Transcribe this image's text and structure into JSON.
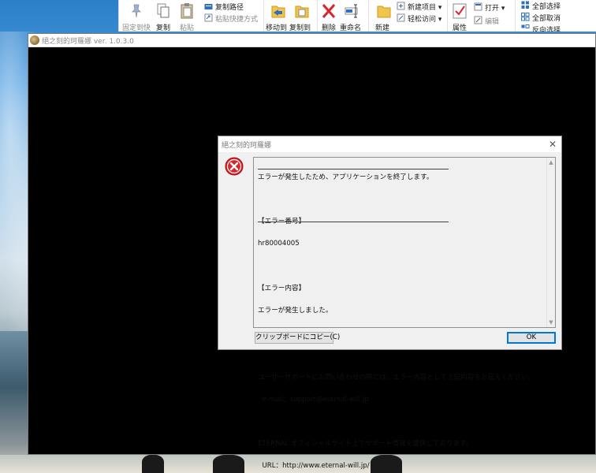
{
  "ribbon": {
    "pin_label": "固定到快",
    "copy_label": "复制",
    "paste_label": "粘贴",
    "copy_path_label": "复制路径",
    "paste_shortcut_label": "粘贴快捷方式",
    "move_to_label": "移动到",
    "copy_to_label": "复制到",
    "delete_label": "删除",
    "rename_label": "重命名",
    "new_folder_label": "新建",
    "new_item_label": "新建项目 ▾",
    "easy_access_label": "轻松访问 ▾",
    "properties_label": "属性",
    "open_label": "打开 ▾",
    "edit_label": "编辑",
    "select_all_label": "全部选择",
    "select_none_label": "全部取消",
    "invert_selection_label": "反向选择"
  },
  "game_window": {
    "title": "絕之刻的珂羅娜 ver. 1.0.3.0"
  },
  "dialog": {
    "title": "絕之刻的珂羅娜",
    "close_glyph": "✕",
    "message_lines": [
      "エラーが発生したため、アプリケーションを終了します。",
      "",
      "【エラー番号】",
      "hr80004005",
      "",
      "【エラー内容】",
      "エラーが発生しました。",
      "",
      "",
      "ユーザーサポートにお問い合わせの際には、エラー内容として上記内容をお伝えください。",
      "  e-mail：support@eternal-will.jp",
      "",
      "ETERNAL オフィシャルサイト上でサポート情報を提供しております。",
      "  URL：http://www.eternal-will.jp/"
    ],
    "copy_button_label": "クリップボードにコピー(C)",
    "ok_button_label": "OK",
    "scroll_up_glyph": "▲",
    "scroll_down_glyph": "▼"
  },
  "icons": {
    "error": "error-icon",
    "app": "app-icon"
  },
  "colors": {
    "error_red": "#d9252b",
    "ok_border": "#0078d7",
    "game_background": "#000000"
  }
}
